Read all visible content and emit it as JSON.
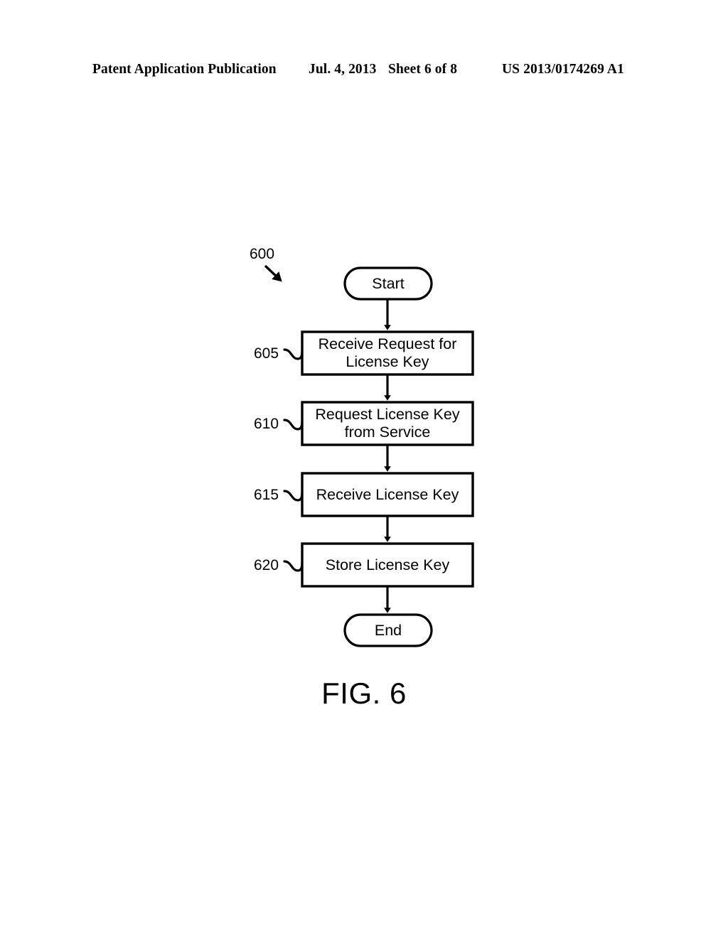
{
  "page": {
    "background_color": "#ffffff",
    "ink_color": "#000000"
  },
  "header": {
    "publication": "Patent Application Publication",
    "date": "Jul. 4, 2013",
    "sheet": "Sheet 6 of 8",
    "patent_number": "US 2013/0174269 A1"
  },
  "figure": {
    "caption": "FIG. 6",
    "diagram_reference": "600",
    "type": "flowchart",
    "nodes": [
      {
        "id": "start",
        "shape": "terminator",
        "label": "Start",
        "ref": null
      },
      {
        "id": "605",
        "shape": "process",
        "label": "Receive Request for\nLicense Key",
        "ref": "605"
      },
      {
        "id": "610",
        "shape": "process",
        "label": "Request License Key\nfrom Service",
        "ref": "610"
      },
      {
        "id": "615",
        "shape": "process",
        "label": "Receive License Key",
        "ref": "615"
      },
      {
        "id": "620",
        "shape": "process",
        "label": "Store License Key",
        "ref": "620"
      },
      {
        "id": "end",
        "shape": "terminator",
        "label": "End",
        "ref": null
      }
    ],
    "edges": [
      {
        "from": "start",
        "to": "605",
        "arrow": "down"
      },
      {
        "from": "605",
        "to": "610",
        "arrow": "down"
      },
      {
        "from": "610",
        "to": "615",
        "arrow": "down"
      },
      {
        "from": "615",
        "to": "620",
        "arrow": "down"
      },
      {
        "from": "620",
        "to": "end",
        "arrow": "down"
      }
    ]
  }
}
